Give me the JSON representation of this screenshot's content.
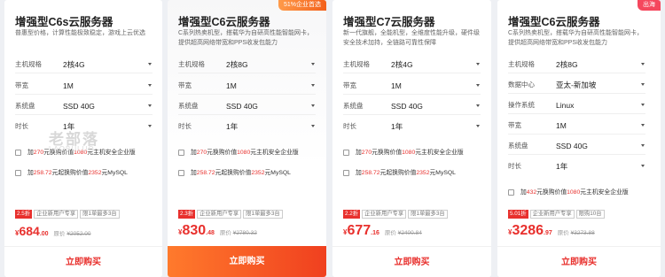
{
  "colors": {
    "accent": "#e8302d",
    "buy_gradient_start": "#ff7a2c",
    "buy_gradient_end": "#f0401f",
    "ribbon_orange": "#f3601b",
    "ribbon_red": "#f5475d"
  },
  "watermark": {
    "main": "老部落",
    "sub": "LAOBULUO"
  },
  "cards": [
    {
      "title": "增强型C6s云服务器",
      "desc": "普惠型价格，计算性能极致稳定，游戏上云优选",
      "rows": [
        {
          "label": "主机规格",
          "value": "2核4G"
        },
        {
          "label": "带宽",
          "value": "1M"
        },
        {
          "label": "系统盘",
          "value": "SSD 40G"
        },
        {
          "label": "时长",
          "value": "1年"
        }
      ],
      "addons": [
        {
          "pre": "加",
          "price": "270",
          "mid": "元换购价值",
          "worth": "1080",
          "post": "元主机安全企业版"
        },
        {
          "pre": "加",
          "price": "258.72",
          "mid": "元起换购价值",
          "worth": "2352",
          "post": "元MySQL"
        }
      ],
      "tags": [
        "2.5折",
        "企业新用户专享",
        "限1单最多3台"
      ],
      "price": {
        "currency": "¥",
        "int": "684",
        "dec": ".00",
        "orig_label": "原价",
        "orig": "¥2052.00"
      },
      "buy": "立即购买"
    },
    {
      "ribbon": "51%企业首选",
      "title": "增强型C6云服务器",
      "desc": "C系列热卖机型，搭载华为自研高性能智能网卡，提供超高网络带宽和PPS收发包能力",
      "rows": [
        {
          "label": "主机规格",
          "value": "2核8G"
        },
        {
          "label": "带宽",
          "value": "1M"
        },
        {
          "label": "系统盘",
          "value": "SSD 40G"
        },
        {
          "label": "时长",
          "value": "1年"
        }
      ],
      "addons": [
        {
          "pre": "加",
          "price": "270",
          "mid": "元换购价值",
          "worth": "1080",
          "post": "元主机安全企业版"
        },
        {
          "pre": "加",
          "price": "258.72",
          "mid": "元起换购价值",
          "worth": "2352",
          "post": "元MySQL"
        }
      ],
      "tags": [
        "2.3折",
        "企业新用户专享",
        "限1单最多3台"
      ],
      "price": {
        "currency": "¥",
        "int": "830",
        "dec": ".48",
        "orig_label": "原价",
        "orig": "¥2780.32"
      },
      "buy": "立即购买"
    },
    {
      "title": "增强型C7云服务器",
      "desc": "新一代旗舰，全能机型，全维度性能升级，硬件级安全技术加持，全链路可靠性保障",
      "rows": [
        {
          "label": "主机规格",
          "value": "2核4G"
        },
        {
          "label": "带宽",
          "value": "1M"
        },
        {
          "label": "系统盘",
          "value": "SSD 40G"
        },
        {
          "label": "时长",
          "value": "1年"
        }
      ],
      "addons": [
        {
          "pre": "加",
          "price": "270",
          "mid": "元换购价值",
          "worth": "1080",
          "post": "元主机安全企业版"
        },
        {
          "pre": "加",
          "price": "258.72",
          "mid": "元起换购价值",
          "worth": "2352",
          "post": "元MySQL"
        }
      ],
      "tags": [
        "2.2折",
        "企业新用户专享",
        "限1单最多3台"
      ],
      "price": {
        "currency": "¥",
        "int": "677",
        "dec": ".16",
        "orig_label": "原价",
        "orig": "¥2400.84"
      },
      "buy": "立即购买"
    },
    {
      "ribbon": "出海",
      "title": "增强型C6云服务器",
      "desc": "C系列热卖机型，搭载华为自研高性能智能网卡，提供超高网络带宽和PPS收发包能力",
      "rows": [
        {
          "label": "主机规格",
          "value": "2核8G"
        },
        {
          "label": "数据中心",
          "value": "亚太-新加坡"
        },
        {
          "label": "操作系统",
          "value": "Linux"
        },
        {
          "label": "带宽",
          "value": "1M"
        },
        {
          "label": "系统盘",
          "value": "SSD 40G"
        },
        {
          "label": "时长",
          "value": "1年"
        }
      ],
      "addons": [
        {
          "pre": "加",
          "price": "432",
          "mid": "元换购价值",
          "worth": "1080",
          "post": "元主机安全企业版"
        }
      ],
      "tags": [
        "5.01折",
        "企业新用户专享",
        "限购10台"
      ],
      "price": {
        "currency": "¥",
        "int": "3286",
        "dec": ".97",
        "orig_label": "原价",
        "orig": "¥3273.88"
      },
      "buy": "立即购买"
    }
  ]
}
